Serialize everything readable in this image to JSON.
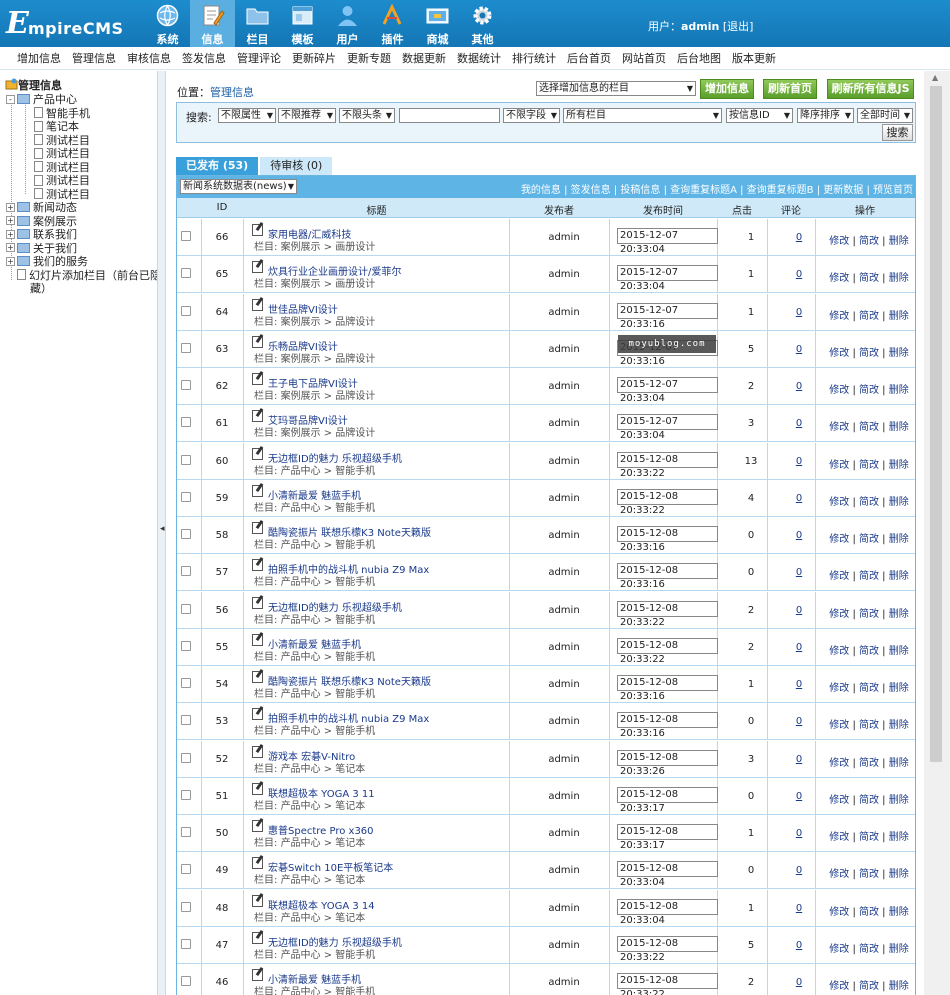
{
  "header": {
    "logo_first": "E",
    "logo_rest": "mpireCMS",
    "nav": [
      {
        "label": "系统",
        "icon": "globe-icon"
      },
      {
        "label": "信息",
        "icon": "notepad-edit-icon",
        "active": true
      },
      {
        "label": "栏目",
        "icon": "folder-icon"
      },
      {
        "label": "模板",
        "icon": "window-icon"
      },
      {
        "label": "用户",
        "icon": "user-icon"
      },
      {
        "label": "插件",
        "icon": "tools-icon"
      },
      {
        "label": "商城",
        "icon": "store-icon"
      },
      {
        "label": "其他",
        "icon": "gear-icon"
      }
    ],
    "user_prefix": "用户：",
    "username": "admin",
    "logout": "[退出]"
  },
  "submenu": [
    "增加信息",
    "管理信息",
    "审核信息",
    "签发信息",
    "管理评论",
    "更新碎片",
    "更新专题",
    "数据更新",
    "数据统计",
    "排行统计",
    "后台首页",
    "网站首页",
    "后台地图",
    "版本更新"
  ],
  "tree": {
    "root": "管理信息",
    "items": [
      {
        "label": "产品中心",
        "level": 1,
        "type": "folder",
        "expand": "-"
      },
      {
        "label": "智能手机",
        "level": 2,
        "type": "doc"
      },
      {
        "label": "笔记本",
        "level": 2,
        "type": "doc"
      },
      {
        "label": "测试栏目",
        "level": 2,
        "type": "doc"
      },
      {
        "label": "测试栏目",
        "level": 2,
        "type": "doc"
      },
      {
        "label": "测试栏目",
        "level": 2,
        "type": "doc"
      },
      {
        "label": "测试栏目",
        "level": 2,
        "type": "doc"
      },
      {
        "label": "测试栏目",
        "level": 2,
        "type": "doc"
      },
      {
        "label": "新闻动态",
        "level": 1,
        "type": "folder",
        "expand": "+"
      },
      {
        "label": "案例展示",
        "level": 1,
        "type": "folder",
        "expand": "+"
      },
      {
        "label": "联系我们",
        "level": 1,
        "type": "folder",
        "expand": "+"
      },
      {
        "label": "关于我们",
        "level": 1,
        "type": "folder",
        "expand": "+"
      },
      {
        "label": "我们的服务",
        "level": 1,
        "type": "folder",
        "expand": "+"
      },
      {
        "label": "幻灯片添加栏目（前台已隐",
        "level": 1,
        "type": "doc"
      },
      {
        "label": "藏）",
        "level": 1,
        "type": "cont"
      }
    ]
  },
  "location": {
    "prefix": "位置：",
    "link": "管理信息"
  },
  "select_column": "选择增加信息的栏目",
  "buttons": {
    "add": "增加信息",
    "refresh_home": "刷新首页",
    "refresh_js": "刷新所有信息JS"
  },
  "search": {
    "label": "搜索:",
    "attr": "不限属性",
    "recommend": "不限推荐",
    "headline": "不限头条",
    "keyword": "",
    "field": "不限字段",
    "column": "所有栏目",
    "order_by": "按信息ID",
    "order": "降序排序",
    "time": "全部时间",
    "button": "搜索"
  },
  "tabs": {
    "published": "已发布 (53)",
    "pending": "待审核 (0)"
  },
  "table_select": "新闻系统数据表(news)",
  "top_links": "我的信息 | 签发信息 | 投稿信息 | 查询重复标题A | 查询重复标题B | 更新数据 | 预览首页",
  "columns": {
    "id": "ID",
    "title": "标题",
    "publisher": "发布者",
    "time": "发布时间",
    "clicks": "点击",
    "comments": "评论",
    "ops": "操作"
  },
  "ops_labels": {
    "edit": "修改",
    "quick": "简改",
    "delete": "删除",
    "sep": " | "
  },
  "cat_prefix": "栏目: ",
  "rows": [
    {
      "id": "66",
      "title": "家用电器/汇威科技",
      "cat": "案例展示 > 画册设计",
      "publisher": "admin",
      "time": "2015-12-07 20:33:04",
      "clicks": "1",
      "comments": "0"
    },
    {
      "id": "65",
      "title": "炊具行业企业画册设计/爱菲尔",
      "cat": "案例展示 > 画册设计",
      "publisher": "admin",
      "time": "2015-12-07 20:33:04",
      "clicks": "1",
      "comments": "0"
    },
    {
      "id": "64",
      "title": "世佳品牌VI设计",
      "cat": "案例展示 > 品牌设计",
      "publisher": "admin",
      "time": "2015-12-07 20:33:16",
      "clicks": "1",
      "comments": "0"
    },
    {
      "id": "63",
      "title": "乐畅品牌VI设计",
      "cat": "案例展示 > 品牌设计",
      "publisher": "admin",
      "time": "2015-12-07 20:33:16",
      "clicks": "5",
      "comments": "0"
    },
    {
      "id": "62",
      "title": "王子电下品牌VI设计",
      "cat": "案例展示 > 品牌设计",
      "publisher": "admin",
      "time": "2015-12-07 20:33:04",
      "clicks": "2",
      "comments": "0"
    },
    {
      "id": "61",
      "title": "艾玛哥品牌VI设计",
      "cat": "案例展示 > 品牌设计",
      "publisher": "admin",
      "time": "2015-12-07 20:33:04",
      "clicks": "3",
      "comments": "0"
    },
    {
      "id": "60",
      "title": "无边框ID的魅力 乐视超级手机",
      "cat": "产品中心 > 智能手机",
      "publisher": "admin",
      "time": "2015-12-08 20:33:22",
      "clicks": "13",
      "comments": "0"
    },
    {
      "id": "59",
      "title": "小清新最爱 魅蓝手机",
      "cat": "产品中心 > 智能手机",
      "publisher": "admin",
      "time": "2015-12-08 20:33:22",
      "clicks": "4",
      "comments": "0"
    },
    {
      "id": "58",
      "title": "酷陶瓷振片 联想乐檬K3 Note天籁版",
      "cat": "产品中心 > 智能手机",
      "publisher": "admin",
      "time": "2015-12-08 20:33:16",
      "clicks": "0",
      "comments": "0"
    },
    {
      "id": "57",
      "title": "拍照手机中的战斗机 nubia Z9 Max",
      "cat": "产品中心 > 智能手机",
      "publisher": "admin",
      "time": "2015-12-08 20:33:16",
      "clicks": "0",
      "comments": "0"
    },
    {
      "id": "56",
      "title": "无边框ID的魅力 乐视超级手机",
      "cat": "产品中心 > 智能手机",
      "publisher": "admin",
      "time": "2015-12-08 20:33:22",
      "clicks": "2",
      "comments": "0"
    },
    {
      "id": "55",
      "title": "小清新最爱 魅蓝手机",
      "cat": "产品中心 > 智能手机",
      "publisher": "admin",
      "time": "2015-12-08 20:33:22",
      "clicks": "2",
      "comments": "0"
    },
    {
      "id": "54",
      "title": "酷陶瓷振片 联想乐檬K3 Note天籁版",
      "cat": "产品中心 > 智能手机",
      "publisher": "admin",
      "time": "2015-12-08 20:33:16",
      "clicks": "1",
      "comments": "0"
    },
    {
      "id": "53",
      "title": "拍照手机中的战斗机 nubia Z9 Max",
      "cat": "产品中心 > 智能手机",
      "publisher": "admin",
      "time": "2015-12-08 20:33:16",
      "clicks": "0",
      "comments": "0"
    },
    {
      "id": "52",
      "title": "游戏本 宏碁V-Nitro",
      "cat": "产品中心 > 笔记本",
      "publisher": "admin",
      "time": "2015-12-08 20:33:26",
      "clicks": "3",
      "comments": "0"
    },
    {
      "id": "51",
      "title": "联想超极本 YOGA 3 11",
      "cat": "产品中心 > 笔记本",
      "publisher": "admin",
      "time": "2015-12-08 20:33:17",
      "clicks": "0",
      "comments": "0"
    },
    {
      "id": "50",
      "title": "惠普Spectre Pro x360",
      "cat": "产品中心 > 笔记本",
      "publisher": "admin",
      "time": "2015-12-08 20:33:17",
      "clicks": "1",
      "comments": "0"
    },
    {
      "id": "49",
      "title": "宏碁Switch 10E平板笔记本",
      "cat": "产品中心 > 笔记本",
      "publisher": "admin",
      "time": "2015-12-08 20:33:04",
      "clicks": "0",
      "comments": "0"
    },
    {
      "id": "48",
      "title": "联想超极本 YOGA 3 14",
      "cat": "产品中心 > 笔记本",
      "publisher": "admin",
      "time": "2015-12-08 20:33:04",
      "clicks": "1",
      "comments": "0"
    },
    {
      "id": "47",
      "title": "无边框ID的魅力 乐视超级手机",
      "cat": "产品中心 > 智能手机",
      "publisher": "admin",
      "time": "2015-12-08 20:33:22",
      "clicks": "5",
      "comments": "0"
    },
    {
      "id": "46",
      "title": "小清新最爱 魅蓝手机",
      "cat": "产品中心 > 智能手机",
      "publisher": "admin",
      "time": "2015-12-08 20:33:22",
      "clicks": "2",
      "comments": "0"
    }
  ],
  "watermark": "moyublog.com",
  "colors": {
    "header": "#1476b5",
    "active_tab": "#3aa0dc",
    "grid_top": "#5fb4e6",
    "green_button": "#5a9e2a"
  }
}
